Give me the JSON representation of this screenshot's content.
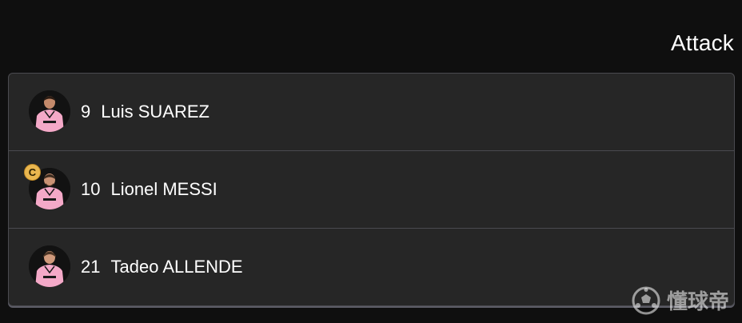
{
  "section": {
    "title": "Attack"
  },
  "players": [
    {
      "number": "9",
      "name": "Luis SUAREZ",
      "captain": false,
      "avatar_icon": "player-avatar-icon"
    },
    {
      "number": "10",
      "name": "Lionel MESSI",
      "captain": true,
      "captain_label": "C",
      "avatar_icon": "player-avatar-icon"
    },
    {
      "number": "21",
      "name": "Tadeo ALLENDE",
      "captain": false,
      "avatar_icon": "player-avatar-icon"
    }
  ],
  "watermark": {
    "text": "懂球帝",
    "icon": "soccer-ball-icon"
  },
  "colors": {
    "background": "#0f0f0f",
    "card": "#262626",
    "jersey_pink": "#f4a9c8",
    "captain_badge": "#e9b64f"
  }
}
